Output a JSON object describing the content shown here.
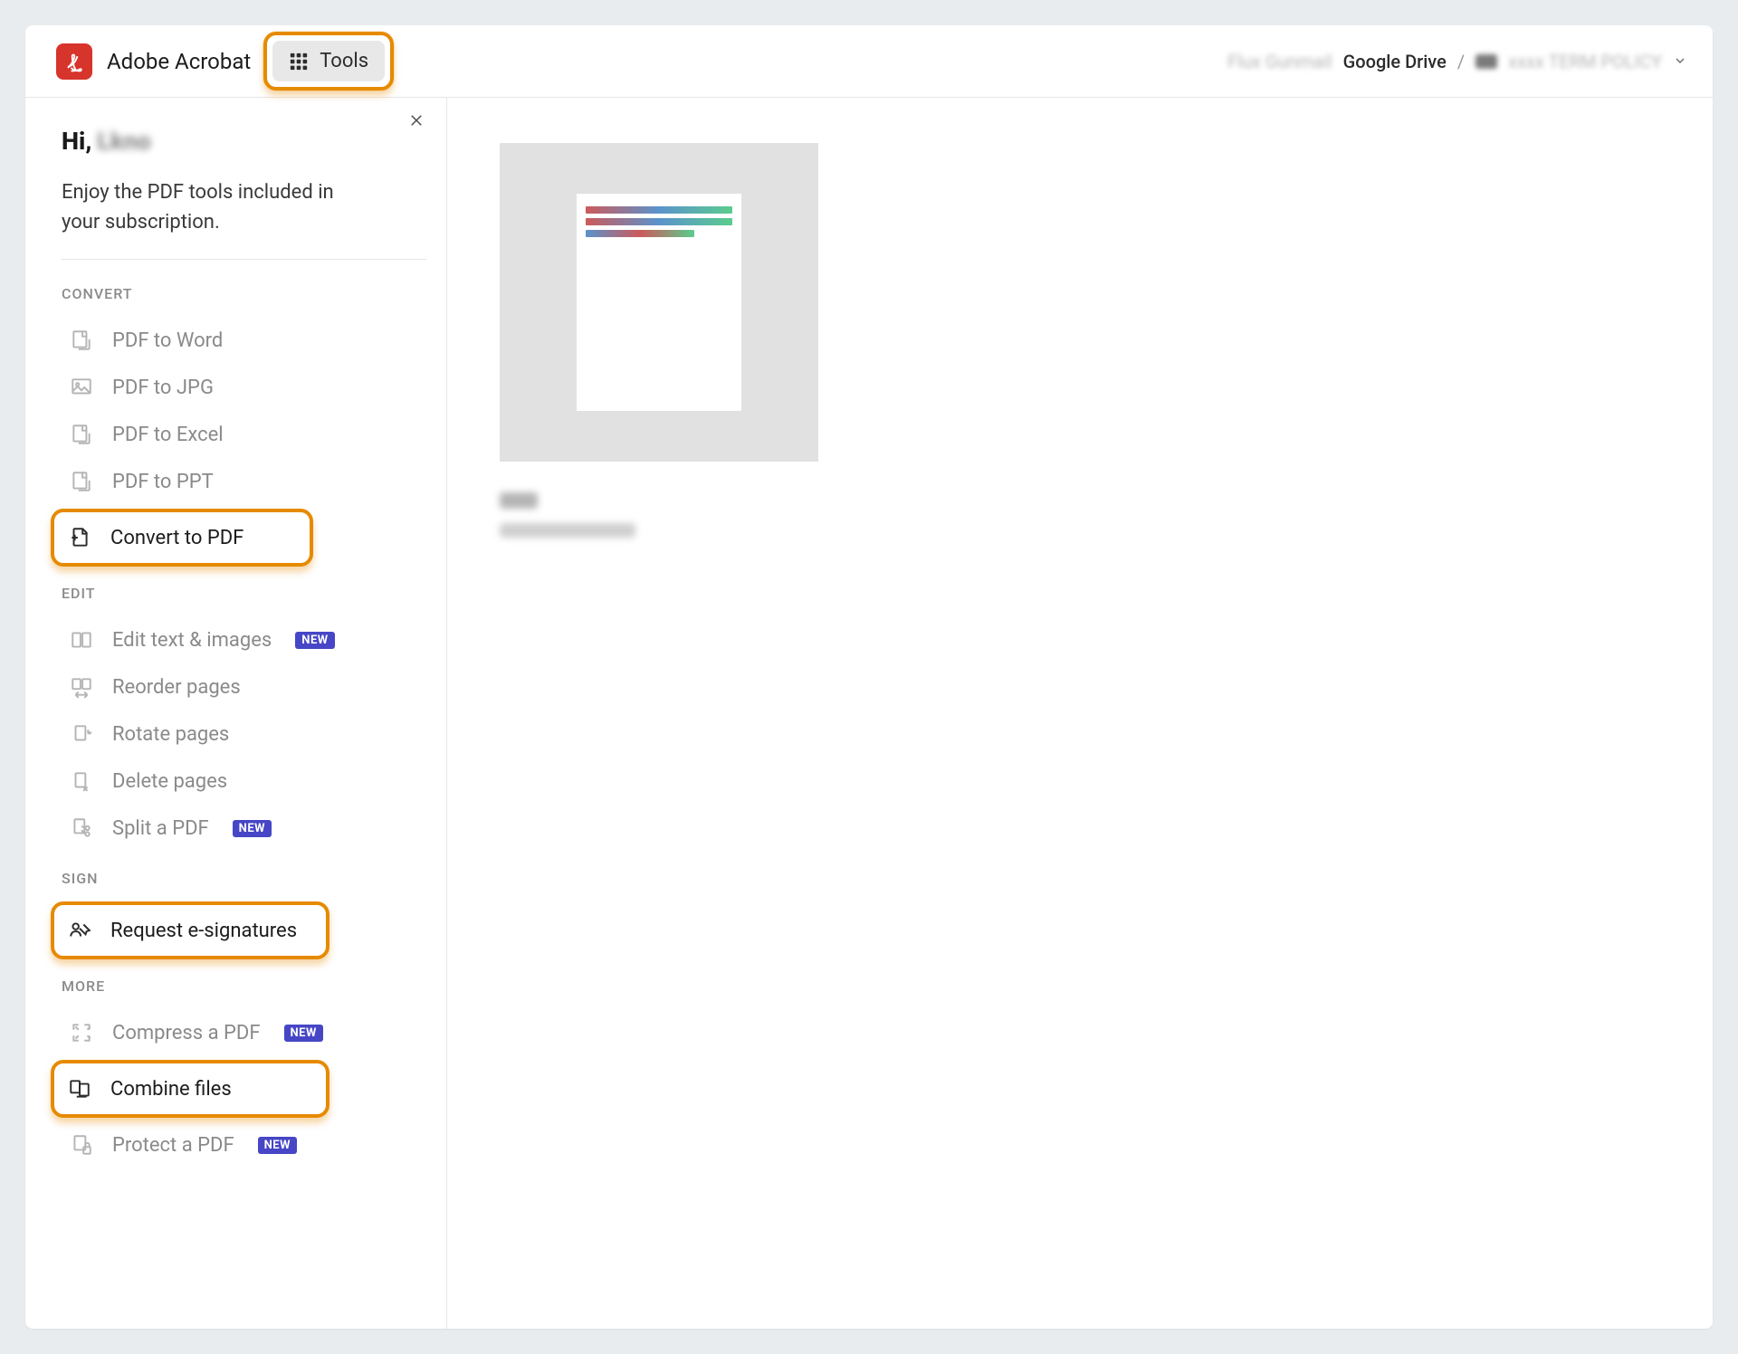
{
  "header": {
    "brand": "Adobe Acrobat",
    "tools_label": "Tools",
    "breadcrumb": {
      "blur1": "Flux Gunmail",
      "drive": "Google Drive",
      "sep": "/",
      "blur_dark": "",
      "blur2": "xxxx TERM POLICY"
    }
  },
  "sidebar": {
    "greeting_prefix": "Hi,",
    "greeting_name": "Lkno",
    "subtitle": "Enjoy the PDF tools included in your subscription.",
    "sections": {
      "convert": "CONVERT",
      "edit": "EDIT",
      "sign": "SIGN",
      "more": "MORE"
    },
    "convert": {
      "pdf_to_word": "PDF to Word",
      "pdf_to_jpg": "PDF to JPG",
      "pdf_to_excel": "PDF to Excel",
      "pdf_to_ppt": "PDF to PPT",
      "convert_to_pdf": "Convert to PDF"
    },
    "edit": {
      "edit_text_images": "Edit text & images",
      "reorder_pages": "Reorder pages",
      "rotate_pages": "Rotate pages",
      "delete_pages": "Delete pages",
      "split_pdf": "Split a PDF"
    },
    "sign": {
      "request_esign": "Request e-signatures"
    },
    "more": {
      "compress": "Compress a PDF",
      "combine": "Combine files",
      "protect": "Protect a PDF"
    },
    "badge_new": "NEW"
  },
  "content": {
    "file_line1": "xx",
    "file_line2": "XXXX TERM POLICY"
  }
}
